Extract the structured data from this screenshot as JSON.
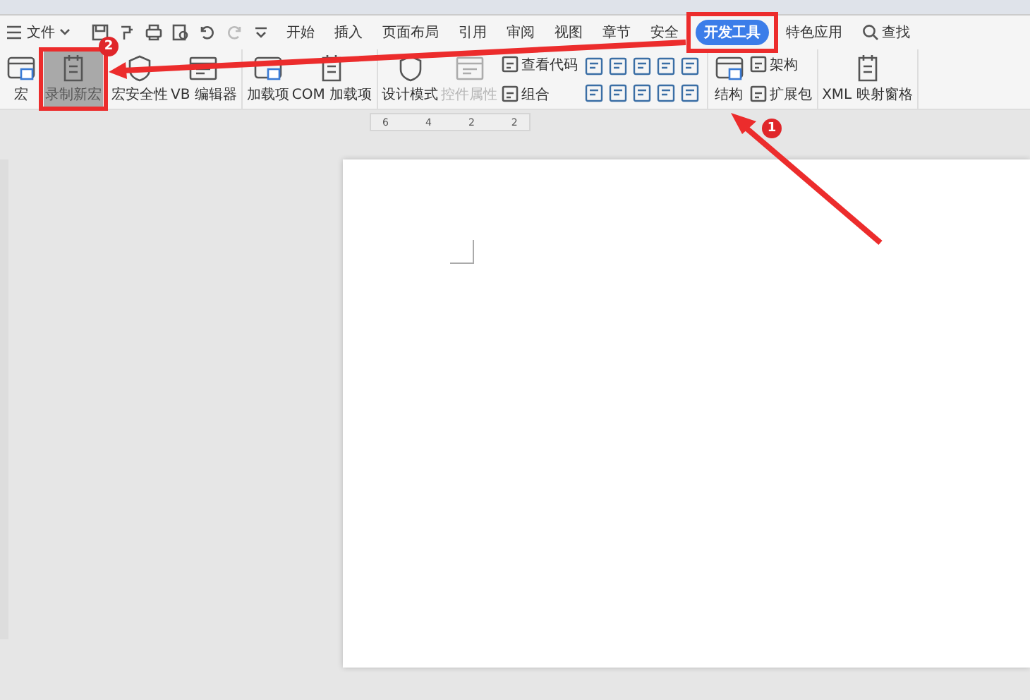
{
  "menu_bar": {
    "file_menu": "文件",
    "tabs": [
      {
        "label": "开始",
        "selected": false
      },
      {
        "label": "插入",
        "selected": false
      },
      {
        "label": "页面布局",
        "selected": false
      },
      {
        "label": "引用",
        "selected": false
      },
      {
        "label": "审阅",
        "selected": false
      },
      {
        "label": "视图",
        "selected": false
      },
      {
        "label": "章节",
        "selected": false
      },
      {
        "label": "安全",
        "selected": false
      },
      {
        "label": "开发工具",
        "selected": true
      },
      {
        "label": "特色应用",
        "selected": false
      }
    ],
    "search": "查找"
  },
  "ribbon": {
    "groups": [
      {
        "items": [
          {
            "kind": "large",
            "label": "宏",
            "highlighted": false,
            "disabled": false
          },
          {
            "kind": "large",
            "label": "录制新宏",
            "highlighted": true,
            "disabled": false
          },
          {
            "kind": "large",
            "label": "宏安全性",
            "highlighted": false,
            "disabled": false
          },
          {
            "kind": "large",
            "label": "VB 编辑器",
            "highlighted": false,
            "disabled": false
          }
        ]
      },
      {
        "items": [
          {
            "kind": "large",
            "label": "加载项",
            "highlighted": false,
            "disabled": false
          },
          {
            "kind": "large",
            "label": "COM 加载项",
            "highlighted": false,
            "disabled": false
          }
        ]
      },
      {
        "items": [
          {
            "kind": "large",
            "label": "设计模式",
            "highlighted": false,
            "disabled": false
          },
          {
            "kind": "large",
            "label": "控件属性",
            "highlighted": false,
            "disabled": true
          },
          {
            "kind": "stack",
            "rows": [
              {
                "label": "查看代码"
              },
              {
                "label": "组合"
              }
            ]
          },
          {
            "kind": "grid"
          }
        ]
      },
      {
        "items": [
          {
            "kind": "large",
            "label": "结构",
            "highlighted": false,
            "disabled": false
          },
          {
            "kind": "stack",
            "rows": [
              {
                "label": "架构"
              },
              {
                "label": "扩展包"
              }
            ]
          }
        ]
      },
      {
        "items": [
          {
            "kind": "large",
            "label": "XML 映射窗格",
            "highlighted": false,
            "disabled": false
          }
        ]
      }
    ]
  },
  "ruler": {
    "ticks": [
      "6",
      "4",
      "2",
      "2"
    ]
  },
  "annotations": [
    {
      "badge": "1"
    },
    {
      "badge": "2"
    }
  ]
}
